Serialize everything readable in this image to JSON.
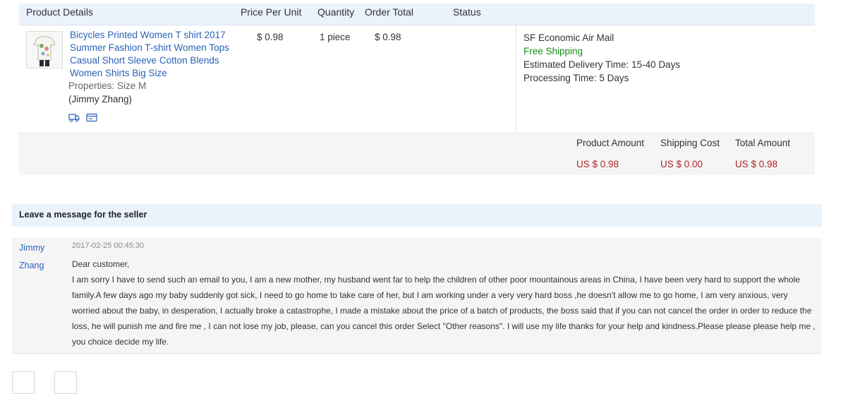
{
  "table": {
    "headers": [
      "Product Details",
      "Price Per Unit",
      "Quantity",
      "Order Total",
      "Status"
    ]
  },
  "product": {
    "title": "Bicycles Printed Women T shirt 2017 Summer Fashion T-shirt Women Tops Casual Short Sleeve Cotton Blends Women Shirts Big Size",
    "properties": "Properties: Size M",
    "buyer": "(Jimmy Zhang)",
    "price": "$ 0.98",
    "quantity": "1 piece",
    "order_total": "$ 0.98",
    "icons": [
      "shipping-truck-icon",
      "payment-card-icon"
    ]
  },
  "shipping": {
    "method": "SF Economic Air Mail",
    "cost_note": "Free Shipping",
    "delivery_label": "Estimated Delivery Time:",
    "delivery_value": "15-40 Days",
    "processing_label": "Processing Time:",
    "processing_value": "5 Days"
  },
  "totals": {
    "product_amount_label": "Product Amount",
    "product_amount": "US $ 0.98",
    "shipping_cost_label": "Shipping Cost",
    "shipping_cost": "US $ 0.00",
    "total_amount_label": "Total Amount",
    "total_amount": "US $ 0.98"
  },
  "message": {
    "section_title": "Leave a message for the seller",
    "author": "Jimmy Zhang",
    "timestamp": "2017-02-25 00:45:30",
    "greeting": "Dear customer,",
    "body": "I am sorry I have to send such an email to you, I am a new mother, my husband went far to help the children of other poor mountainous areas in China, I have been very hard to support the whole family.A few days ago my baby suddenly got sick, I need to go home to take care of her, but I am working under a very very hard boss ,he doesn't allow me to go home, I am very anxious, very worried about the baby, in desperation, I actually broke a catastrophe, I made a mistake about the price of a batch of products, the boss said that if you can not cancel the order in order to reduce the loss, he will punish me and fire me , I can not lose my job, please, can you cancel this order Select \"Other reasons\". I will use my life thanks for your help and kindness.Please please please help me , you choice decide my life."
  },
  "colors": {
    "link": "#2a62b5",
    "price_red": "#b0222a",
    "free_shipping_green": "#1a8f1a",
    "header_bg": "#eaf2fc"
  }
}
